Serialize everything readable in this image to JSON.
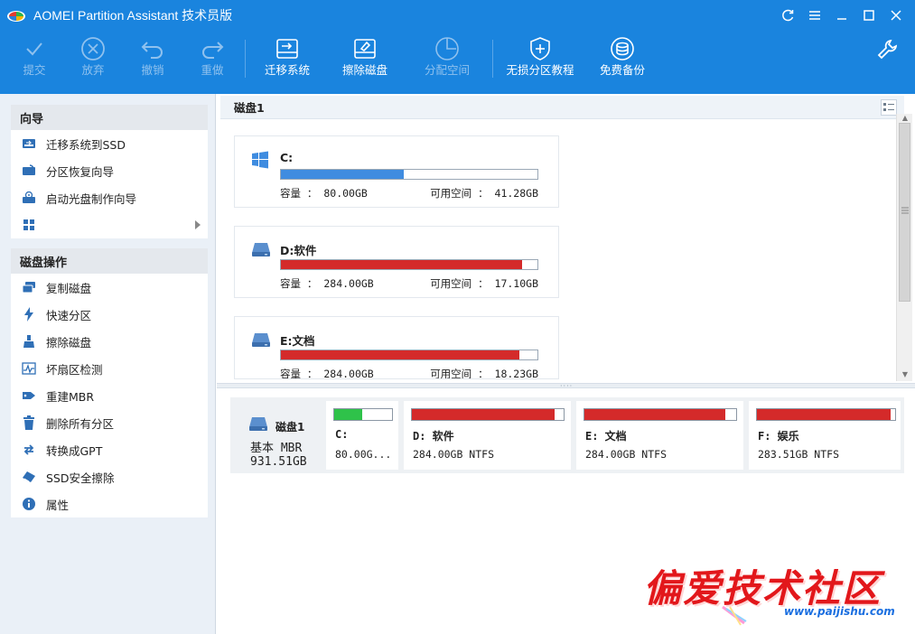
{
  "window": {
    "title": "AOMEI Partition Assistant 技术员版",
    "controls": [
      "refresh-icon",
      "menu-icon",
      "minimize-icon",
      "maximize-icon",
      "close-icon"
    ]
  },
  "toolbar": {
    "items": [
      {
        "label": "提交",
        "icon": "check-icon",
        "enabled": false
      },
      {
        "label": "放弃",
        "icon": "discard-icon",
        "enabled": false
      },
      {
        "label": "撤销",
        "icon": "undo-icon",
        "enabled": false
      },
      {
        "label": "重做",
        "icon": "redo-icon",
        "enabled": false
      },
      {
        "label": "迁移系统",
        "icon": "migrate-os-icon",
        "enabled": true
      },
      {
        "label": "擦除磁盘",
        "icon": "wipe-disk-icon",
        "enabled": true
      },
      {
        "label": "分配空间",
        "icon": "allocate-space-icon",
        "enabled": false
      },
      {
        "label": "无损分区教程",
        "icon": "shield-icon",
        "enabled": true
      },
      {
        "label": "免费备份",
        "icon": "backup-icon",
        "enabled": true
      }
    ],
    "tools_icon": "wrench-icon"
  },
  "sidebar": {
    "wizard": {
      "header": "向导",
      "items": [
        {
          "label": "迁移系统到SSD",
          "icon": "migrate-ssd-icon"
        },
        {
          "label": "分区恢复向导",
          "icon": "partition-recovery-icon"
        },
        {
          "label": "启动光盘制作向导",
          "icon": "bootable-media-icon"
        },
        {
          "label": "",
          "icon": "more-apps-icon"
        }
      ]
    },
    "disk_ops": {
      "header": "磁盘操作",
      "items": [
        {
          "label": "复制磁盘",
          "icon": "copy-disk-icon"
        },
        {
          "label": "快速分区",
          "icon": "lightning-icon"
        },
        {
          "label": "擦除磁盘",
          "icon": "eraser-icon"
        },
        {
          "label": "坏扇区检测",
          "icon": "bad-sector-icon"
        },
        {
          "label": "重建MBR",
          "icon": "rebuild-mbr-icon"
        },
        {
          "label": "删除所有分区",
          "icon": "delete-partitions-icon"
        },
        {
          "label": "转换成GPT",
          "icon": "convert-icon"
        },
        {
          "label": "SSD安全擦除",
          "icon": "ssd-erase-icon"
        },
        {
          "label": "属性",
          "icon": "info-icon"
        }
      ]
    }
  },
  "disk_view": {
    "disk_label": "磁盘1",
    "partitions": [
      {
        "name": "C:",
        "icon": "windows-icon",
        "capacity_text": "容量 ： 80.00GB",
        "free_text": "可用空间 ： 41.28GB",
        "used_fraction": 0.48,
        "color": "#3f8ce0"
      },
      {
        "name": "D:软件",
        "icon": "drive-icon",
        "capacity_text": "容量 ： 284.00GB",
        "free_text": "可用空间 ： 17.10GB",
        "used_fraction": 0.94,
        "color": "#d42a2a"
      },
      {
        "name": "E:文档",
        "icon": "drive-icon",
        "capacity_text": "容量 ： 284.00GB",
        "free_text": "可用空间 ： 18.23GB",
        "used_fraction": 0.93,
        "color": "#d42a2a"
      }
    ]
  },
  "disk_map": {
    "disk_name": "磁盘1",
    "disk_type": "基本 MBR",
    "disk_size": "931.51GB",
    "partitions": [
      {
        "name": "C:",
        "info": "80.00G...",
        "used_fraction": 0.48,
        "color": "#2fc24a"
      },
      {
        "name": "D: 软件",
        "info": "284.00GB NTFS",
        "used_fraction": 0.94,
        "color": "#d42a2a"
      },
      {
        "name": "E: 文档",
        "info": "284.00GB NTFS",
        "used_fraction": 0.93,
        "color": "#d42a2a"
      },
      {
        "name": "F: 娱乐",
        "info": "283.51GB NTFS",
        "used_fraction": 0.97,
        "color": "#d42a2a"
      }
    ]
  },
  "watermark": {
    "text": "偏爱技术社区",
    "url": "www.paijishu.com"
  }
}
